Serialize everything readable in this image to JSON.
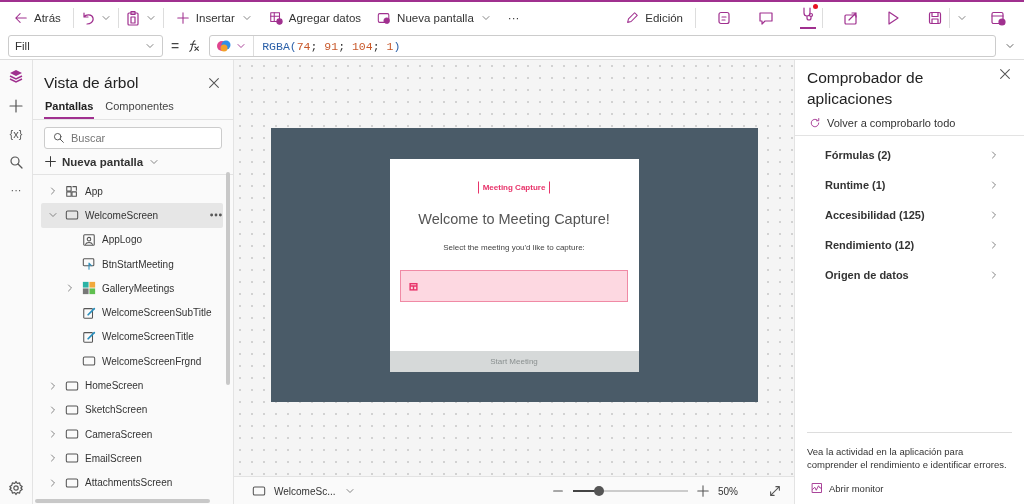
{
  "toolbar": {
    "back": "Atrás",
    "insert": "Insertar",
    "add_data": "Agregar datos",
    "new_screen": "Nueva pantalla",
    "more": "···",
    "mode": "Edición"
  },
  "formula_bar": {
    "property": "Fill",
    "equals": "=",
    "tokens": [
      {
        "text": "RGBA(",
        "kind": "function"
      },
      {
        "text": "74",
        "kind": "number"
      },
      {
        "text": "; ",
        "kind": "punct"
      },
      {
        "text": "91",
        "kind": "number"
      },
      {
        "text": "; ",
        "kind": "punct"
      },
      {
        "text": "104",
        "kind": "number"
      },
      {
        "text": "; ",
        "kind": "punct"
      },
      {
        "text": "1",
        "kind": "number"
      },
      {
        "text": ")",
        "kind": "function"
      }
    ]
  },
  "rail": {
    "variables": "{x}",
    "more": "···"
  },
  "tree": {
    "title": "Vista de árbol",
    "tabs": [
      {
        "label": "Pantallas",
        "selected": true
      },
      {
        "label": "Componentes",
        "selected": false
      }
    ],
    "search_placeholder": "Buscar",
    "new_screen": "Nueva pantalla",
    "items": [
      {
        "label": "App",
        "kind": "app",
        "expanded": false,
        "selected": false
      },
      {
        "label": "WelcomeScreen",
        "kind": "screen",
        "expanded": true,
        "selected": true,
        "children": [
          {
            "label": "AppLogo",
            "kind": "image",
            "selected": false
          },
          {
            "label": "BtnStartMeeting",
            "kind": "button",
            "selected": false
          },
          {
            "label": "GalleryMeetings",
            "kind": "gallery",
            "expanded": false,
            "selected": false
          },
          {
            "label": "WelcomeScreenSubTitle",
            "kind": "label",
            "selected": false
          },
          {
            "label": "WelcomeScreenTitle",
            "kind": "label",
            "selected": false
          },
          {
            "label": "WelcomeScreenFrgnd",
            "kind": "rectangle",
            "selected": false
          }
        ]
      },
      {
        "label": "HomeScreen",
        "kind": "screen",
        "expanded": false,
        "selected": false
      },
      {
        "label": "SketchScreen",
        "kind": "screen",
        "expanded": false,
        "selected": false
      },
      {
        "label": "CameraScreen",
        "kind": "screen",
        "expanded": false,
        "selected": false
      },
      {
        "label": "EmailScreen",
        "kind": "screen",
        "expanded": false,
        "selected": false
      },
      {
        "label": "AttachmentsScreen",
        "kind": "screen",
        "expanded": false,
        "selected": false
      }
    ]
  },
  "canvas": {
    "logo": "Meeting Capture",
    "title": "Welcome to Meeting Capture!",
    "subtitle": "Select the meeting you'd like to capture:",
    "button": "Start Meeting",
    "button_disabled": true
  },
  "status_bar": {
    "screen": "WelcomeSc...",
    "level": 0.23,
    "zoom": "50%"
  },
  "checker": {
    "title": "Comprobador de aplicaciones",
    "recheck": "Volver a comprobarlo todo",
    "categories": [
      "Fórmulas (2)",
      "Runtime (1)",
      "Accesibilidad (125)",
      "Rendimiento (12)",
      "Origen de datos"
    ],
    "footer": "Vea la actividad en la aplicación para comprender el rendimiento e identificar errores.",
    "monitor": "Abrir monitor"
  }
}
